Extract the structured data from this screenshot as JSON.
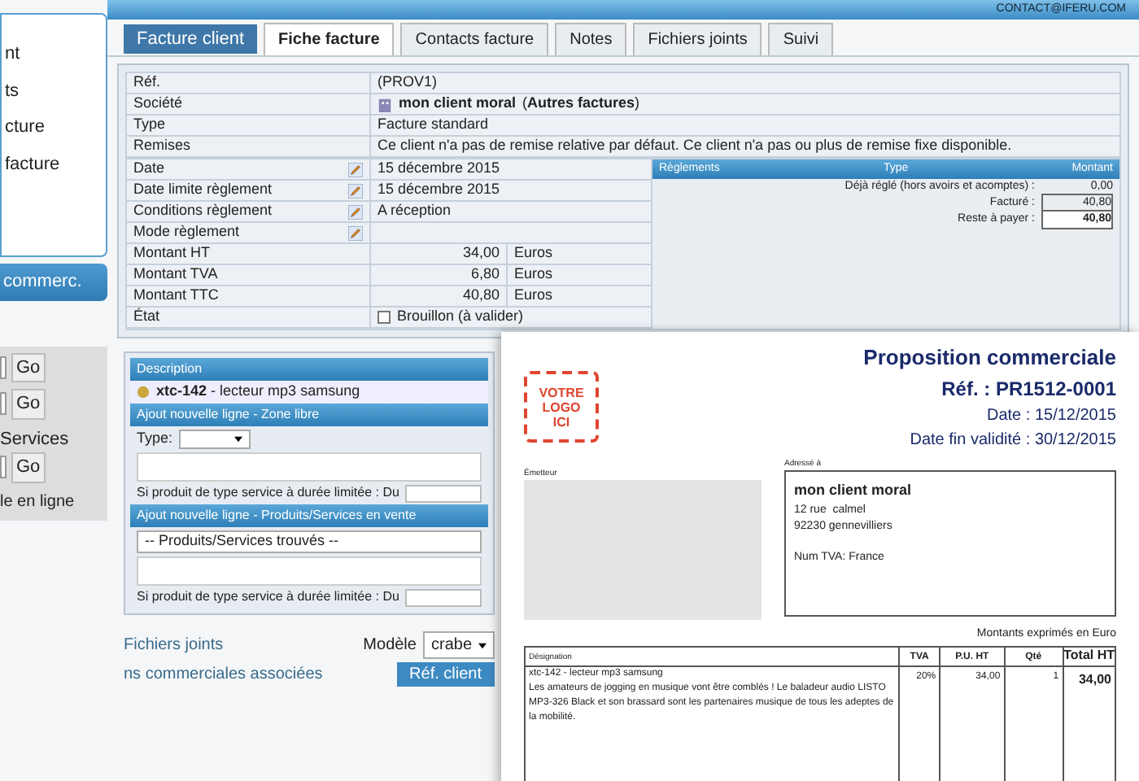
{
  "header": {
    "contact": "CONTACT@IFERU.COM"
  },
  "sidebar": {
    "items": [
      "nt",
      "ts",
      "cture",
      "facture"
    ],
    "section": "commerc.",
    "search_rows": [
      {
        "button": "Go"
      },
      {
        "button": "Go"
      },
      {
        "label": "Services",
        "button": "Go"
      }
    ],
    "footer": "le en ligne"
  },
  "invoice": {
    "badge": "Facture client",
    "tabs": [
      {
        "label": "Fiche facture",
        "selected": true
      },
      {
        "label": "Contacts facture",
        "selected": false
      },
      {
        "label": "Notes",
        "selected": false
      },
      {
        "label": "Fichiers joints",
        "selected": false
      },
      {
        "label": "Suivi",
        "selected": false
      }
    ],
    "top_fields": [
      {
        "label": "Réf.",
        "kind": "text",
        "value": "(PROV1)"
      },
      {
        "label": "Société",
        "kind": "company",
        "value": "mon client moral",
        "link": "(**Autres factures**)"
      },
      {
        "label": "Type",
        "kind": "text",
        "value": "Facture standard"
      },
      {
        "label": "Remises",
        "kind": "text",
        "value": "Ce client n'a pas de remise relative par défaut. Ce client n'a pas ou plus de remise fixe disponible."
      }
    ],
    "fields": [
      {
        "label": "Date",
        "kind": "text",
        "editable": true,
        "value": "15 décembre 2015"
      },
      {
        "label": "Date limite règlement",
        "kind": "text",
        "editable": true,
        "value": "15 décembre 2015"
      },
      {
        "label": "Conditions règlement",
        "kind": "text",
        "editable": true,
        "value": "A réception"
      },
      {
        "label": "Mode règlement",
        "kind": "text",
        "editable": true
      },
      {
        "label": "Montant HT",
        "kind": "amount",
        "editable": false,
        "value": "34,00",
        "unit": "Euros"
      },
      {
        "label": "Montant TVA",
        "kind": "amount",
        "editable": false,
        "value": "6,80",
        "unit": "Euros"
      },
      {
        "label": "Montant TTC",
        "kind": "amount",
        "editable": false,
        "value": "40,80",
        "unit": "Euros"
      },
      {
        "label": "État",
        "kind": "checkbox",
        "editable": false,
        "checked": false,
        "value": "Brouillon (à valider)"
      }
    ],
    "payments": {
      "columns": [
        "Règlements",
        "Type",
        "Montant"
      ],
      "lines": [
        {
          "label": "Déjà réglé (hors avoirs et acomptes) :",
          "value": "0,00",
          "kind": "plain"
        },
        {
          "label": "Facturé :",
          "value": "40,80",
          "kind": "boxed"
        },
        {
          "label": "Reste à payer :",
          "value": "40,80",
          "kind": "total"
        }
      ]
    }
  },
  "lines": {
    "header": "Description",
    "product": {
      "ref": "xtc-142",
      "label": "- lecteur mp3 samsung"
    },
    "free_zone": {
      "title": "Ajout nouvelle ligne - Zone libre",
      "type_label": "Type:",
      "service_text": "Si produit de type service à durée limitée : Du"
    },
    "predefined": {
      "title": "Ajout nouvelle ligne - Produits/Services en vente",
      "select": "-- Produits/Services trouvés --",
      "service_text": "Si produit de type service à durée limitée : Du"
    }
  },
  "bottom": {
    "files_title": "Fichiers joints",
    "model_label": "Modèle",
    "model_value": "crabe",
    "linked_title": "ns commerciales associées",
    "linked_column": "Réf. client"
  },
  "document": {
    "title": "Proposition commerciale",
    "ref": "Réf. : PR1512-0001",
    "date": "Date : 15/12/2015",
    "validity": "Date fin validité : 30/12/2015",
    "logo": [
      "VOTRE",
      "LOGO",
      "ICI"
    ],
    "emitter_label": "Émetteur",
    "recipient_label": "Adressé à",
    "recipient": {
      "name": "mon client moral",
      "lines": [
        "12 rue  calmel",
        "92230 gennevilliers"
      ],
      "vat": "Num TVA: France"
    },
    "currency_note": "Montants exprimés en Euro",
    "columns": [
      "Désignation",
      "TVA",
      "P.U. HT",
      "Qté",
      "Total HT"
    ],
    "row": {
      "title": "xtc-142 - lecteur mp3 samsung",
      "description": "Les amateurs de jogging en musique vont être comblés ! Le baladeur audio LISTO MP3-326 Black et son brassard sont les partenaires musique de tous les adeptes de la mobilité.",
      "vat": "20%",
      "price": "34,00",
      "qty": "1",
      "total": "34,00"
    }
  }
}
